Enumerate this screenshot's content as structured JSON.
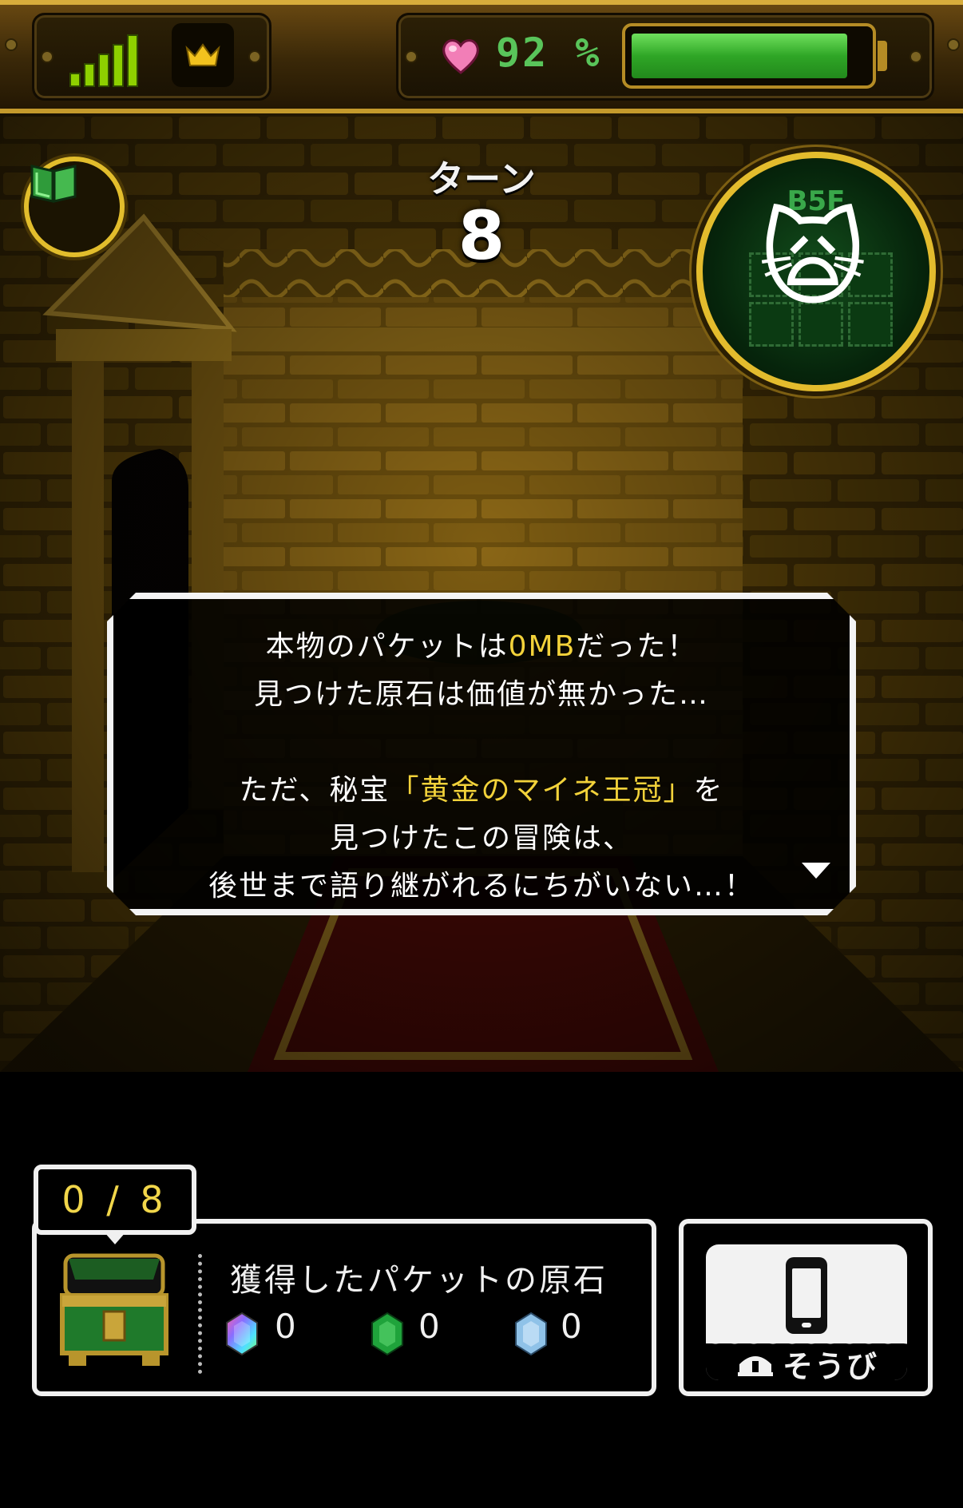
{
  "status_bar": {
    "signal_icon": "signal-bars-icon",
    "crown_icon": "crown-icon",
    "heart_icon": "heart-icon",
    "battery_percent_text": "92 %",
    "battery_fill_fraction": 0.92,
    "battery_color": "#2fa626"
  },
  "hud": {
    "book_icon": "green-book-icon",
    "turn_label": "ターン",
    "turn_value": "8",
    "minimap": {
      "floor": "B5F",
      "character_icon": "weary-cat-face-icon"
    }
  },
  "dialog": {
    "line1_pre": "本物のパケットは",
    "line1_hl": "0MB",
    "line1_post": "だった！",
    "line2": "見つけた原石は価値が無かった…",
    "line3_pre": "ただ、秘宝",
    "line3_hl": "「黄金のマイネ王冠」",
    "line3_post": "を",
    "line4": "見つけたこの冒険は、",
    "line5": "後世まで語り継がれるにちがいない…！",
    "highlight_color": "#f2d23a"
  },
  "inventory": {
    "counter": "0 / 8",
    "chest_icon": "treasure-chest-icon",
    "title": "獲得したパケットの原石",
    "gems": [
      {
        "icon": "rainbow-gem-icon",
        "count": "0"
      },
      {
        "icon": "green-gem-icon",
        "count": "0"
      },
      {
        "icon": "blue-gem-icon",
        "count": "0"
      }
    ]
  },
  "equip": {
    "phone_icon": "smartphone-icon",
    "helmet_icon": "helmet-icon",
    "label": "そうび"
  }
}
